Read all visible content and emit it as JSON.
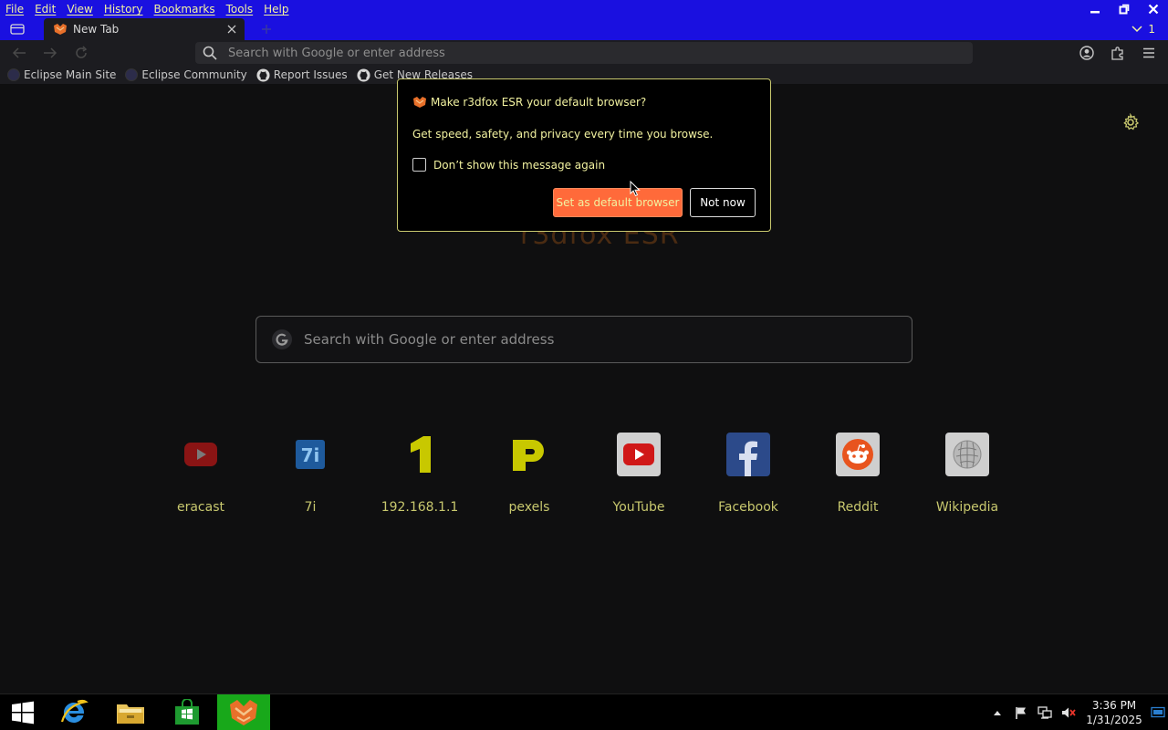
{
  "menubar": {
    "items": [
      "File",
      "Edit",
      "View",
      "History",
      "Bookmarks",
      "Tools",
      "Help"
    ]
  },
  "tabs": {
    "active_title": "New Tab",
    "overflow_count": "1"
  },
  "navbar": {
    "url_placeholder": "Search with Google or enter address"
  },
  "bookmarks": [
    {
      "label": "Eclipse Main Site",
      "icon": "site-icon"
    },
    {
      "label": "Eclipse Community",
      "icon": "site-icon"
    },
    {
      "label": "Report Issues",
      "icon": "github-icon"
    },
    {
      "label": "Get New Releases",
      "icon": "github-icon"
    }
  ],
  "content": {
    "brand_text": "r3dfox ESR",
    "search_placeholder": "Search with Google or enter address",
    "shortcuts": [
      {
        "label": "eracast",
        "icon": "youtube-icon"
      },
      {
        "label": "7i",
        "icon": "7i-icon"
      },
      {
        "label": "192.168.1.1",
        "icon": "digit-one-icon"
      },
      {
        "label": "pexels",
        "icon": "pexels-icon"
      },
      {
        "label": "YouTube",
        "icon": "youtube-icon"
      },
      {
        "label": "Facebook",
        "icon": "facebook-icon"
      },
      {
        "label": "Reddit",
        "icon": "reddit-icon"
      },
      {
        "label": "Wikipedia",
        "icon": "wikipedia-icon"
      }
    ]
  },
  "popup": {
    "title": "Make r3dfox ESR your default browser?",
    "body": "Get speed, safety, and privacy every time you browse.",
    "checkbox_label": "Don’t show this message again",
    "primary_label": "Set as default browser",
    "secondary_label": "Not now"
  },
  "taskbar": {
    "time": "3:36 PM",
    "date": "1/31/2025"
  },
  "colors": {
    "titlebar": "#1a10e0",
    "accent_text": "#f2f2a0",
    "primary_button": "#ff6a3a",
    "shortcut_label": "#c8c86e",
    "taskbar_active": "#18a81a"
  }
}
